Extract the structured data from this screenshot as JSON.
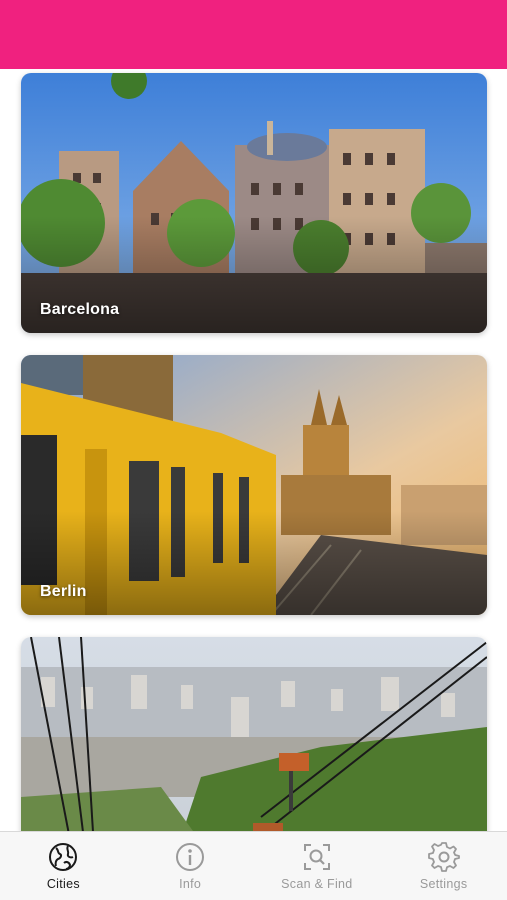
{
  "header": {
    "color": "#f0217f"
  },
  "cities": [
    {
      "name": "Barcelona"
    },
    {
      "name": "Berlin"
    },
    {
      "name": ""
    }
  ],
  "tabbar": {
    "active_color": "#1a1a1a",
    "inactive_color": "#9a9a9a",
    "tabs": [
      {
        "label": "Cities",
        "icon": "globe-icon",
        "active": true
      },
      {
        "label": "Info",
        "icon": "info-icon",
        "active": false
      },
      {
        "label": "Scan & Find",
        "icon": "scan-icon",
        "active": false
      },
      {
        "label": "Settings",
        "icon": "gear-icon",
        "active": false
      }
    ]
  }
}
